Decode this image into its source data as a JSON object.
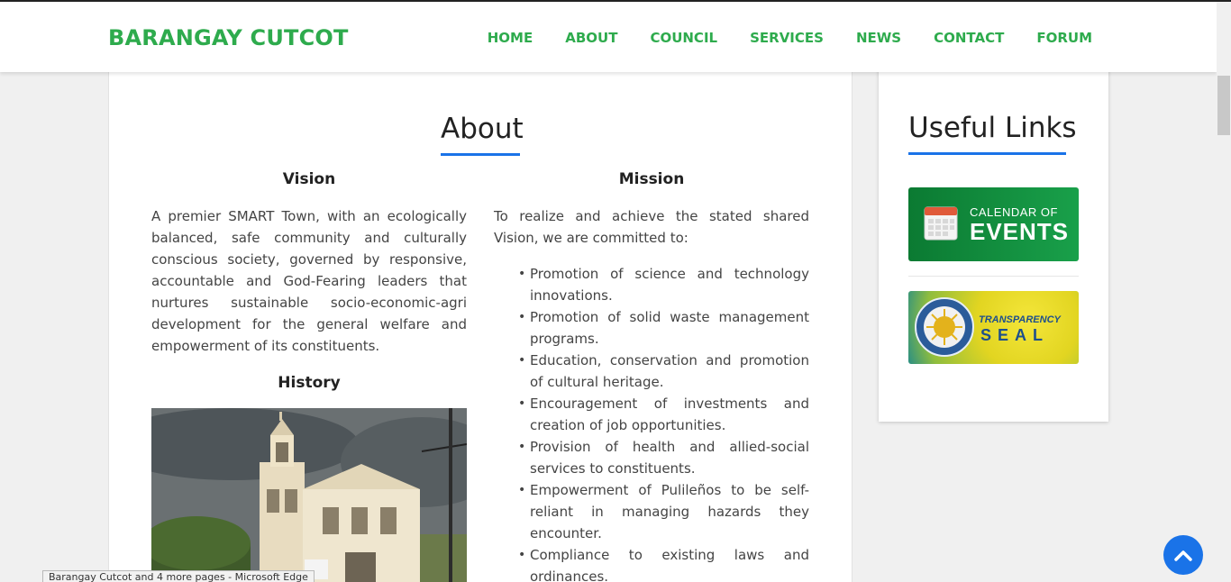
{
  "header": {
    "brand": "BARANGAY CUTCOT",
    "nav": [
      "HOME",
      "ABOUT",
      "COUNCIL",
      "SERVICES",
      "NEWS",
      "CONTACT",
      "FORUM"
    ]
  },
  "about": {
    "title": "About",
    "vision_heading": "Vision",
    "vision_text": "A premier SMART Town, with an ecologically balanced, safe community and culturally conscious society, governed by responsive, accountable and God-Fearing leaders that nurtures sustainable socio-economic-agri development for the general welfare and empowerment of its constituents.",
    "history_heading": "History",
    "mission_heading": "Mission",
    "mission_intro": "To realize and achieve the stated shared Vision, we are committed to:",
    "mission_items": [
      "Promotion of science and technology innovations.",
      "Promotion of solid waste management programs.",
      "Education, conservation and promotion of cultural heritage.",
      "Encouragement of investments and creation of job opportunities.",
      "Provision of health and allied-social services to constituents.",
      "Empowerment of Pulileños to be self-reliant in managing hazards they encounter.",
      "Compliance to existing laws and ordinances."
    ]
  },
  "sidebar": {
    "title": "Useful Links",
    "events_banner": {
      "line1": "CALENDAR OF",
      "line2": "EVENTS"
    },
    "seal_banner": {
      "line1": "TRANSPARENCY",
      "line2": "SEAL"
    }
  },
  "status_bar": "Barangay Cutcot and 4 more pages - Microsoft Edge",
  "colors": {
    "brand_green": "#2eab4d",
    "accent_blue": "#1a73e8"
  }
}
